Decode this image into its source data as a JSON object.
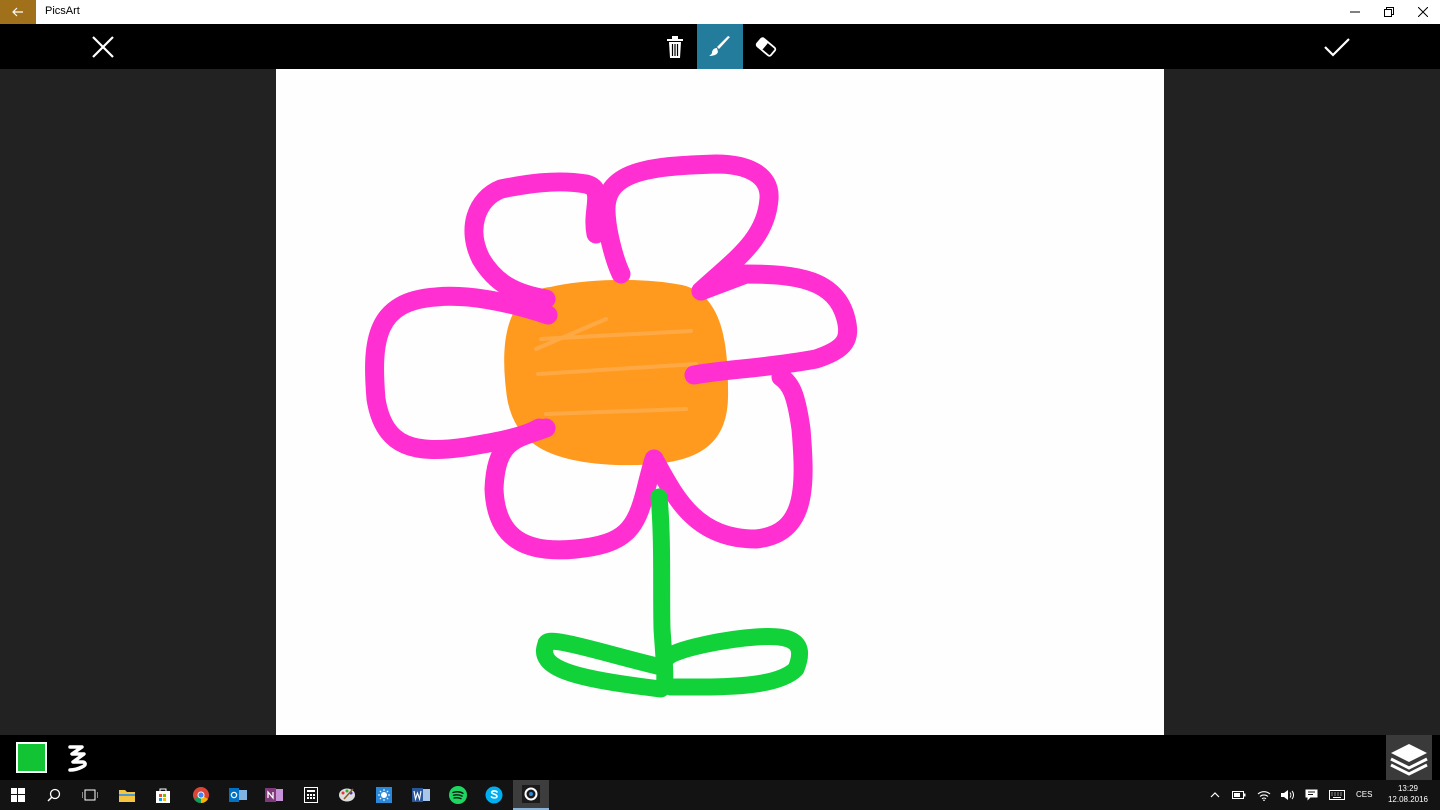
{
  "window": {
    "title": "PicsArt"
  },
  "toolbar": {
    "close_icon": "close-icon",
    "delete_icon": "trash-icon",
    "brush_icon": "brush-icon",
    "eraser_icon": "eraser-icon",
    "confirm_icon": "checkmark-icon",
    "active_tool": "brush"
  },
  "drawing": {
    "background": "#fefefe",
    "petal_color": "#ff2fd2",
    "center_color": "#ff9a1f",
    "stem_color": "#12d23a"
  },
  "bottom_bar": {
    "selected_color": "#12c333",
    "brush_style_icon": "squiggle-icon",
    "layers_icon": "layers-icon"
  },
  "taskbar": {
    "apps": [
      "start",
      "search",
      "task-view",
      "file-explorer",
      "store",
      "chrome",
      "outlook",
      "onenote",
      "calculator",
      "paint",
      "weather",
      "word",
      "spotify",
      "skype",
      "picsart"
    ],
    "language": "CES",
    "time": "13:29",
    "date": "12.08.2016"
  }
}
